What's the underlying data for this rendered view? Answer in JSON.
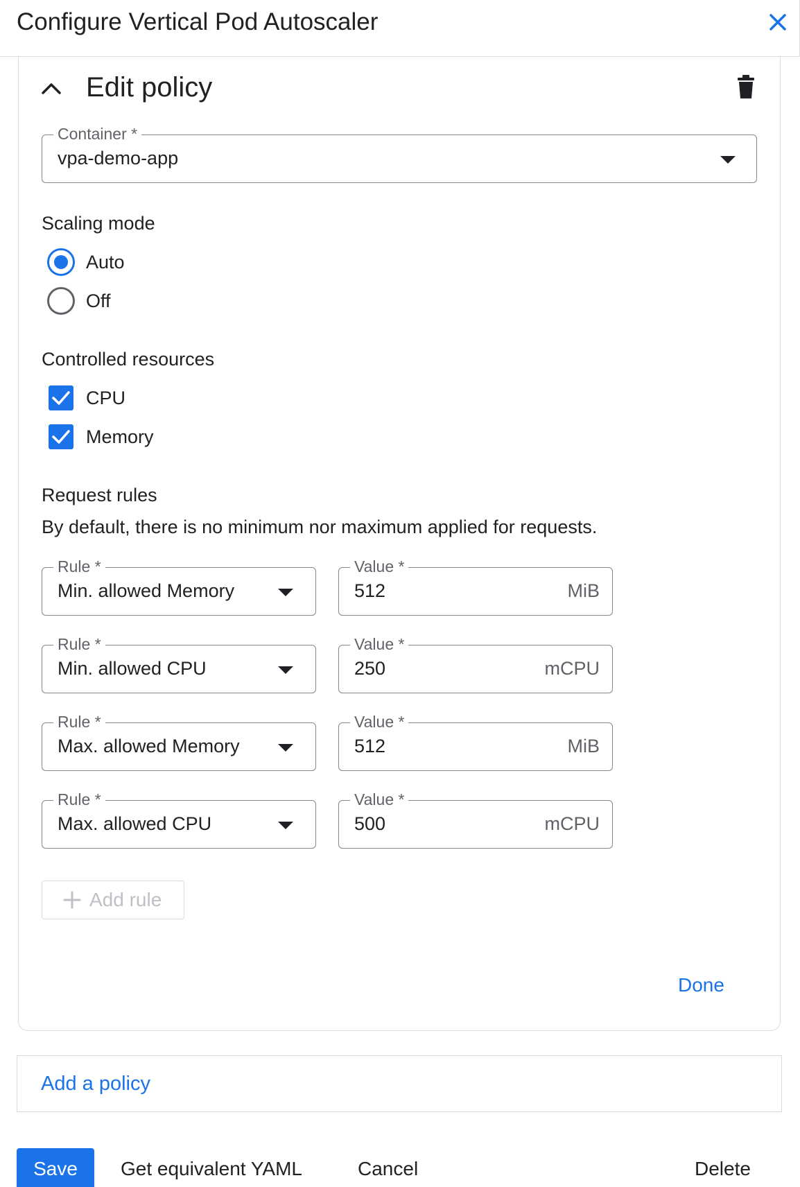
{
  "header": {
    "title": "Configure Vertical Pod Autoscaler",
    "close_icon": "close-icon",
    "accent_color": "#1a73e8"
  },
  "policy": {
    "title": "Edit policy",
    "container": {
      "label": "Container *",
      "value": "vpa-demo-app"
    },
    "scaling_mode": {
      "label": "Scaling mode",
      "options": [
        {
          "label": "Auto",
          "selected": true
        },
        {
          "label": "Off",
          "selected": false
        }
      ]
    },
    "controlled_resources": {
      "label": "Controlled resources",
      "options": [
        {
          "label": "CPU",
          "checked": true
        },
        {
          "label": "Memory",
          "checked": true
        }
      ]
    },
    "request_rules": {
      "label": "Request rules",
      "helper": "By default, there is no minimum nor maximum applied for requests.",
      "rules": [
        {
          "rule_label": "Rule *",
          "rule": "Min. allowed Memory",
          "value_label": "Value *",
          "value": "512",
          "unit": "MiB"
        },
        {
          "rule_label": "Rule *",
          "rule": "Min. allowed CPU",
          "value_label": "Value *",
          "value": "250",
          "unit": "mCPU"
        },
        {
          "rule_label": "Rule *",
          "rule": "Max. allowed Memory",
          "value_label": "Value *",
          "value": "512",
          "unit": "MiB"
        },
        {
          "rule_label": "Rule *",
          "rule": "Max. allowed CPU",
          "value_label": "Value *",
          "value": "500",
          "unit": "mCPU"
        }
      ],
      "add_rule": "Add rule"
    },
    "done": "Done"
  },
  "add_policy": "Add a policy",
  "footer": {
    "save": "Save",
    "yaml": "Get equivalent YAML",
    "cancel": "Cancel",
    "delete": "Delete"
  }
}
